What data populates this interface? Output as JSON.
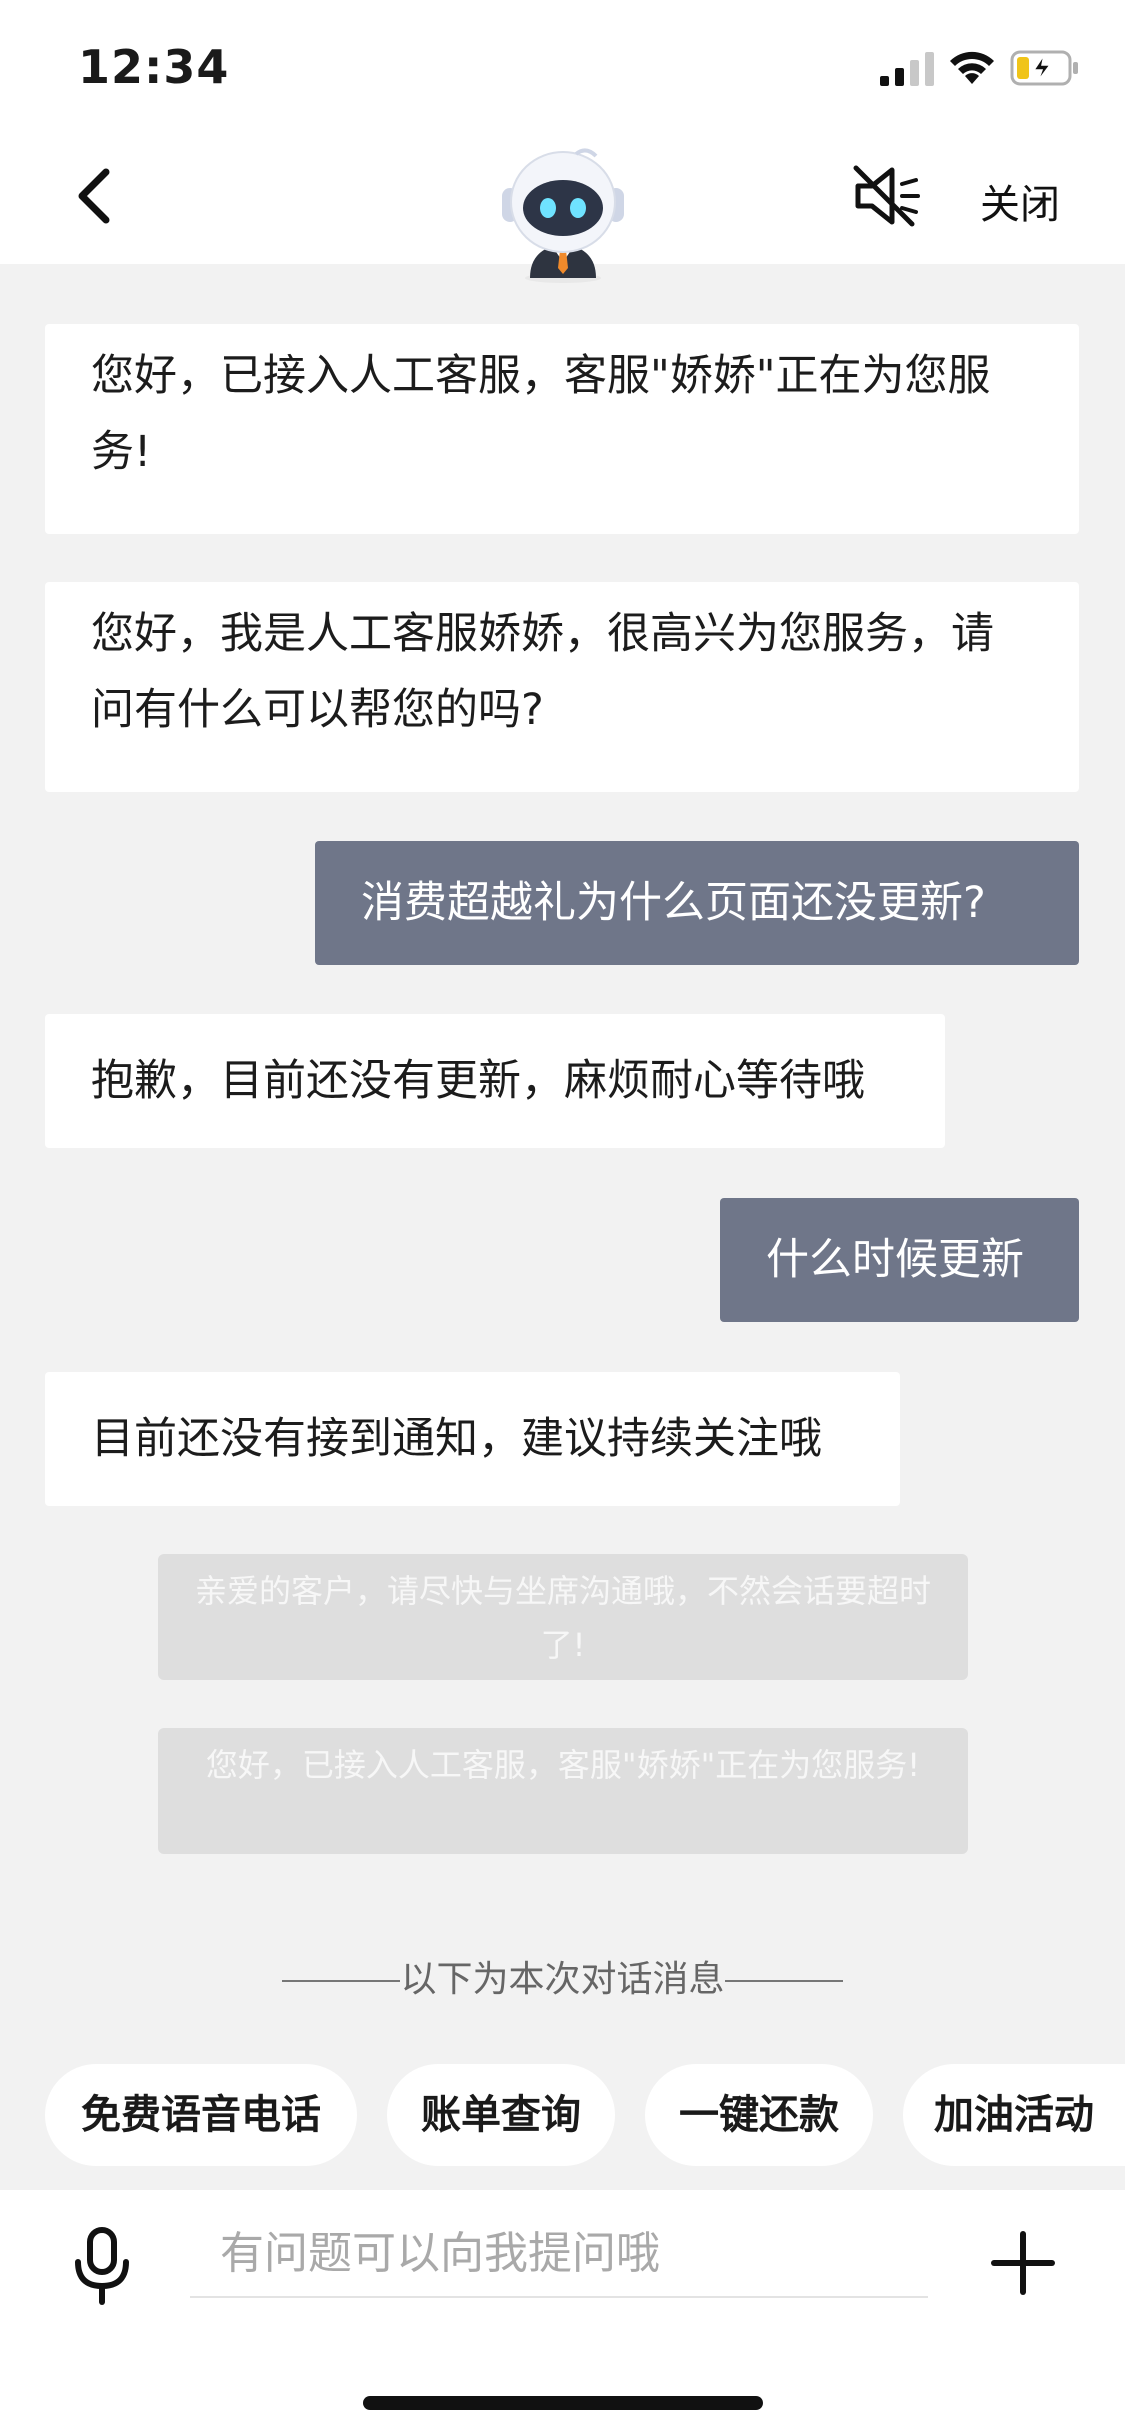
{
  "status_bar": {
    "time": "12:34"
  },
  "header": {
    "close_label": "关闭"
  },
  "messages": [
    {
      "text": "您好，已接入人工客服，客服\"娇娇\"正在为您服务!"
    },
    {
      "text": "您好，我是人工客服娇娇，很高兴为您服务，请问有什么可以帮您的吗?"
    },
    {
      "text": "消费超越礼为什么页面还没更新?"
    },
    {
      "text": "抱歉，目前还没有更新，麻烦耐心等待哦"
    },
    {
      "text": "什么时候更新"
    },
    {
      "text": "目前还没有接到通知，建议持续关注哦"
    }
  ],
  "system_notices": [
    {
      "text": "亲爱的客户，请尽快与坐席沟通哦，不然会话要超时了!"
    },
    {
      "text": "您好，已接入人工客服，客服\"娇娇\"正在为您服务!"
    }
  ],
  "divider_text": "以下为本次对话消息",
  "quick_actions": [
    {
      "label": "免费语音电话"
    },
    {
      "label": "账单查询"
    },
    {
      "label": "一键还款"
    },
    {
      "label": "加油活动"
    }
  ],
  "input": {
    "placeholder": "有问题可以向我提问哦"
  },
  "colors": {
    "outgoing_bubble": "#6f7689",
    "background": "#f2f2f2"
  }
}
